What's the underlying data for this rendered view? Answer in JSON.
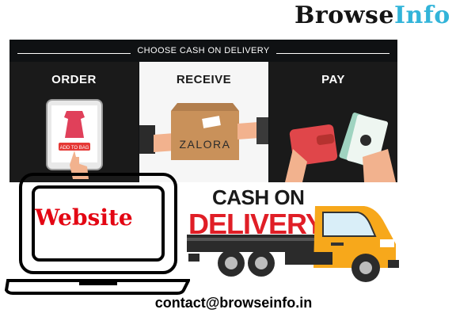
{
  "brand": {
    "part1": "Browse",
    "part2": "Info"
  },
  "banner": {
    "title": "CHOOSE CASH ON DELIVERY",
    "steps": [
      {
        "label": "ORDER",
        "button": "ADD TO BAG"
      },
      {
        "label": "RECEIVE",
        "box_label": "ZALORA"
      },
      {
        "label": "PAY"
      }
    ]
  },
  "laptop": {
    "screen_text": "Website"
  },
  "cod_logo": {
    "line1": "CASH ON",
    "line2": "DELIVERY"
  },
  "contact": "contact@browseinfo.in",
  "colors": {
    "brand_dark": "#141414",
    "brand_blue": "#32b4d9",
    "red": "#e30613",
    "truck_orange": "#f7a81b"
  }
}
